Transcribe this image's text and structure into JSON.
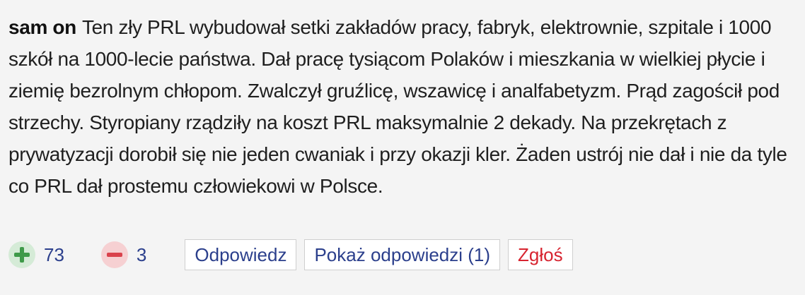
{
  "comment": {
    "author": "sam on",
    "text": "Ten zły PRL wybudował setki zakładów pracy, fabryk, elektrownie, szpitale i 1000 szkół na 1000-lecie państwa. Dał pracę tysiącom Polaków i mieszkania w wielkiej płycie i ziemię bezrolnym chłopom. Zwalczył gruźlicę, wszawicę i analfabetyzm. Prąd zagościł pod strzechy. Styropiany rządziły na koszt PRL maksymalnie 2 dekady. Na przekrętach z prywatyzacji dorobił się nie jeden cwaniak i przy okazji kler. Żaden ustrój nie dał i nie da tyle co PRL dał prostemu człowiekowi w Polsce."
  },
  "votes": {
    "up_count": "73",
    "down_count": "3"
  },
  "actions": {
    "reply_label": "Odpowiedz",
    "show_replies_label": "Pokaż odpowiedzi (1)",
    "report_label": "Zgłoś"
  },
  "icons": {
    "upvote": "plus-icon",
    "downvote": "minus-icon"
  },
  "colors": {
    "upvote_icon": "#3f9a4a",
    "upvote_bg": "#d5ebd7",
    "downvote_icon": "#d9424c",
    "downvote_bg": "#f6d0d2",
    "link_blue": "#2b3f8c",
    "report_red": "#d72430"
  }
}
